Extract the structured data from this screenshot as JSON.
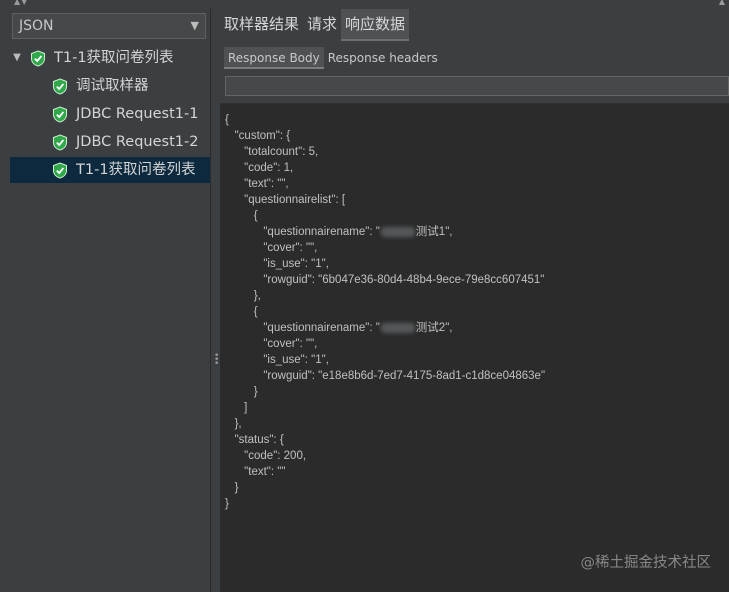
{
  "sampler_combo": {
    "value": "JSON"
  },
  "tree": {
    "root": "T1-1获取问卷列表",
    "children": [
      "调试取样器",
      "JDBC Request1-1",
      "JDBC Request1-2",
      "T1-1获取问卷列表"
    ]
  },
  "tabs": [
    "取样器结果",
    "请求",
    "响应数据"
  ],
  "subtabs": [
    "Response Body",
    "Response headers"
  ],
  "json_lines": {
    "l1": "{",
    "l2": "   \"custom\": {",
    "l3": "      \"totalcount\": 5,",
    "l4": "      \"code\": 1,",
    "l5": "      \"text\": \"\",",
    "l6": "      \"questionnairelist\": [",
    "l7": "         {",
    "l8a": "            \"questionnairename\": \"",
    "l8b": "测试1\",",
    "l9": "            \"cover\": \"\",",
    "l10": "            \"is_use\": \"1\",",
    "l11": "            \"rowguid\": \"6b047e36-80d4-48b4-9ece-79e8cc607451\"",
    "l12": "         },",
    "l13": "         {",
    "l14a": "            \"questionnairename\": \"",
    "l14b": "测试2\",",
    "l15": "            \"cover\": \"\",",
    "l16": "            \"is_use\": \"1\",",
    "l17": "            \"rowguid\": \"e18e8b6d-7ed7-4175-8ad1-c1d8ce04863e\"",
    "l18": "         }",
    "l19": "      ]",
    "l20": "   },",
    "l21": "   \"status\": {",
    "l22": "      \"code\": 200,",
    "l23": "      \"text\": \"\"",
    "l24": "   }",
    "l25": "}"
  },
  "watermark": "@稀土掘金技术社区",
  "colors": {
    "shield": "#2fa84a",
    "selected_bg": "#0d293e",
    "editor_bg": "#2b2b2b"
  }
}
